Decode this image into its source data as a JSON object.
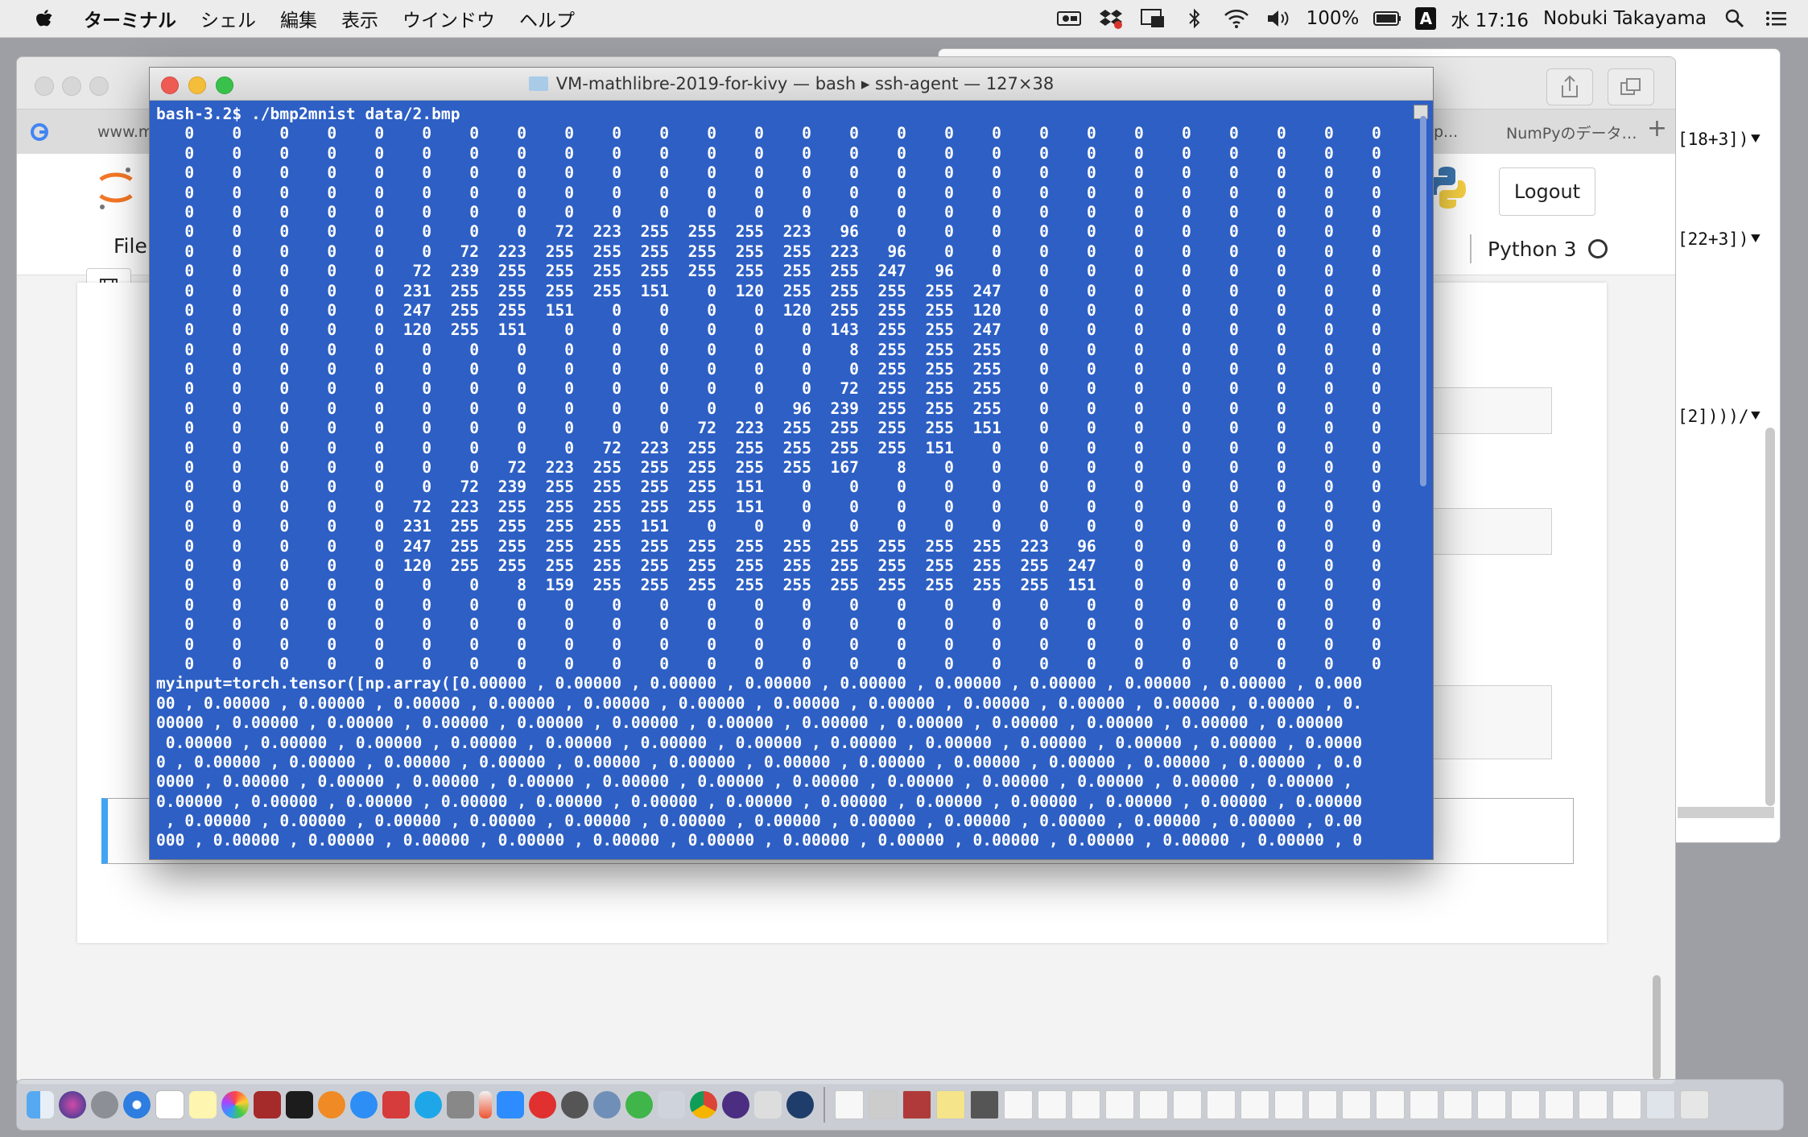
{
  "menubar": {
    "app_name": "ターミナル",
    "menus": [
      "シェル",
      "編集",
      "表示",
      "ウインドウ",
      "ヘルプ"
    ],
    "battery": "100%",
    "input_mode": "A",
    "clock": "水 17:16",
    "user": "Nobuki Takayama"
  },
  "browser": {
    "tabs": [
      "www.m",
      "p...",
      "NumPyのデータ…"
    ],
    "logout_label": "Logout",
    "kernel_name": "Python 3",
    "file_menu": "File"
  },
  "background_terminal": {
    "lines": [
      "[18+3])⯆",
      "[22+3])⯆",
      "[2])))/⯆"
    ]
  },
  "terminal": {
    "title": "VM-mathlibre-2019-for-kivy — bash ▸ ssh-agent — 127×38",
    "lines": [
      "bash-3.2$ ./bmp2mnist data/2.bmp",
      "   0    0    0    0    0    0    0    0    0    0    0    0    0    0    0    0    0    0    0    0    0    0    0    0    0    0    0    0",
      "   0    0    0    0    0    0    0    0    0    0    0    0    0    0    0    0    0    0    0    0    0    0    0    0    0    0    0    0",
      "   0    0    0    0    0    0    0    0    0    0    0    0    0    0    0    0    0    0    0    0    0    0    0    0    0    0    0    0",
      "   0    0    0    0    0    0    0    0    0    0    0    0    0    0    0    0    0    0    0    0    0    0    0    0    0    0    0    0",
      "   0    0    0    0    0    0    0    0    0    0    0    0    0    0    0    0    0    0    0    0    0    0    0    0    0    0    0    0",
      "   0    0    0    0    0    0    0    0   72  223  255  255  255  223   96    0    0    0    0    0    0    0    0    0    0    0    0    0",
      "   0    0    0    0    0    0   72  223  255  255  255  255  255  255  223   96    0    0    0    0    0    0    0    0    0    0    0    0",
      "   0    0    0    0    0   72  239  255  255  255  255  255  255  255  255  247   96    0    0    0    0    0    0    0    0    0    0    0",
      "   0    0    0    0    0  231  255  255  255  255  151    0  120  255  255  255  255  247    0    0    0    0    0    0    0    0    0    0",
      "   0    0    0    0    0  247  255  255  151    0    0    0    0  120  255  255  255  120    0    0    0    0    0    0    0    0    0    0",
      "   0    0    0    0    0  120  255  151    0    0    0    0    0    0  143  255  255  247    0    0    0    0    0    0    0    0    0    0",
      "   0    0    0    0    0    0    0    0    0    0    0    0    0    0    8  255  255  255    0    0    0    0    0    0    0    0    0    0",
      "   0    0    0    0    0    0    0    0    0    0    0    0    0    0    0  255  255  255    0    0    0    0    0    0    0    0    0    0",
      "   0    0    0    0    0    0    0    0    0    0    0    0    0    0   72  255  255  255    0    0    0    0    0    0    0    0    0    0",
      "   0    0    0    0    0    0    0    0    0    0    0    0    0   96  239  255  255  255    0    0    0    0    0    0    0    0    0    0",
      "   0    0    0    0    0    0    0    0    0    0    0   72  223  255  255  255  255  151    0    0    0    0    0    0    0    0    0    0",
      "   0    0    0    0    0    0    0    0    0   72  223  255  255  255  255  255  151    0    0    0    0    0    0    0    0    0    0    0",
      "   0    0    0    0    0    0    0   72  223  255  255  255  255  255  167    8    0    0    0    0    0    0    0    0    0    0    0    0",
      "   0    0    0    0    0    0   72  239  255  255  255  255  151    0    0    0    0    0    0    0    0    0    0    0    0    0    0    0",
      "   0    0    0    0    0   72  223  255  255  255  255  255  151    0    0    0    0    0    0    0    0    0    0    0    0    0    0    0",
      "   0    0    0    0    0  231  255  255  255  255  151    0    0    0    0    0    0    0    0    0    0    0    0    0    0    0    0    0",
      "   0    0    0    0    0  247  255  255  255  255  255  255  255  255  255  255  255  255  223   96    0    0    0    0    0    0    0    0",
      "   0    0    0    0    0  120  255  255  255  255  255  255  255  255  255  255  255  255  255  247    0    0    0    0    0    0    0    0",
      "   0    0    0    0    0    0    0    8  159  255  255  255  255  255  255  255  255  255  255  151    0    0    0    0    0    0    0    0",
      "   0    0    0    0    0    0    0    0    0    0    0    0    0    0    0    0    0    0    0    0    0    0    0    0    0    0    0    0",
      "   0    0    0    0    0    0    0    0    0    0    0    0    0    0    0    0    0    0    0    0    0    0    0    0    0    0    0    0",
      "   0    0    0    0    0    0    0    0    0    0    0    0    0    0    0    0    0    0    0    0    0    0    0    0    0    0    0    0",
      "   0    0    0    0    0    0    0    0    0    0    0    0    0    0    0    0    0    0    0    0    0    0    0    0    0    0    0    0",
      "myinput=torch.tensor([np.array([0.00000 , 0.00000 , 0.00000 , 0.00000 , 0.00000 , 0.00000 , 0.00000 , 0.00000 , 0.00000 , 0.000",
      "00 , 0.00000 , 0.00000 , 0.00000 , 0.00000 , 0.00000 , 0.00000 , 0.00000 , 0.00000 , 0.00000 , 0.00000 , 0.00000 , 0.00000 , 0.",
      "00000 , 0.00000 , 0.00000 , 0.00000 , 0.00000 , 0.00000 , 0.00000 , 0.00000 , 0.00000 , 0.00000 , 0.00000 , 0.00000 , 0.00000 ",
      " 0.00000 , 0.00000 , 0.00000 , 0.00000 , 0.00000 , 0.00000 , 0.00000 , 0.00000 , 0.00000 , 0.00000 , 0.00000 , 0.00000 , 0.0000",
      "0 , 0.00000 , 0.00000 , 0.00000 , 0.00000 , 0.00000 , 0.00000 , 0.00000 , 0.00000 , 0.00000 , 0.00000 , 0.00000 , 0.00000 , 0.0",
      "0000 , 0.00000 , 0.00000 , 0.00000 , 0.00000 , 0.00000 , 0.00000 , 0.00000 , 0.00000 , 0.00000 , 0.00000 , 0.00000 , 0.00000 , ",
      "0.00000 , 0.00000 , 0.00000 , 0.00000 , 0.00000 , 0.00000 , 0.00000 , 0.00000 , 0.00000 , 0.00000 , 0.00000 , 0.00000 , 0.00000",
      " , 0.00000 , 0.00000 , 0.00000 , 0.00000 , 0.00000 , 0.00000 , 0.00000 , 0.00000 , 0.00000 , 0.00000 , 0.00000 , 0.00000 , 0.00",
      "000 , 0.00000 , 0.00000 , 0.00000 , 0.00000 , 0.00000 , 0.00000 , 0.00000 , 0.00000 , 0.00000 , 0.00000 , 0.00000 , 0.00000 , 0"
    ]
  },
  "colors": {
    "terminal_bg": "#2d5fc4",
    "close": "#ee5b52",
    "minimize": "#f4be3b",
    "zoom": "#39c14c"
  },
  "dock_icons": [
    "finder",
    "siri",
    "launchpad",
    "safari",
    "calendar",
    "notes",
    "photos",
    "photo-booth",
    "terminal",
    "vlc",
    "app-store",
    "preferences",
    "skype",
    "tool",
    "pen",
    "zoom",
    "f5",
    "system",
    "r-studio",
    "refresh",
    "printer",
    "chrome",
    "eclipse",
    "x11",
    "quicktime"
  ]
}
